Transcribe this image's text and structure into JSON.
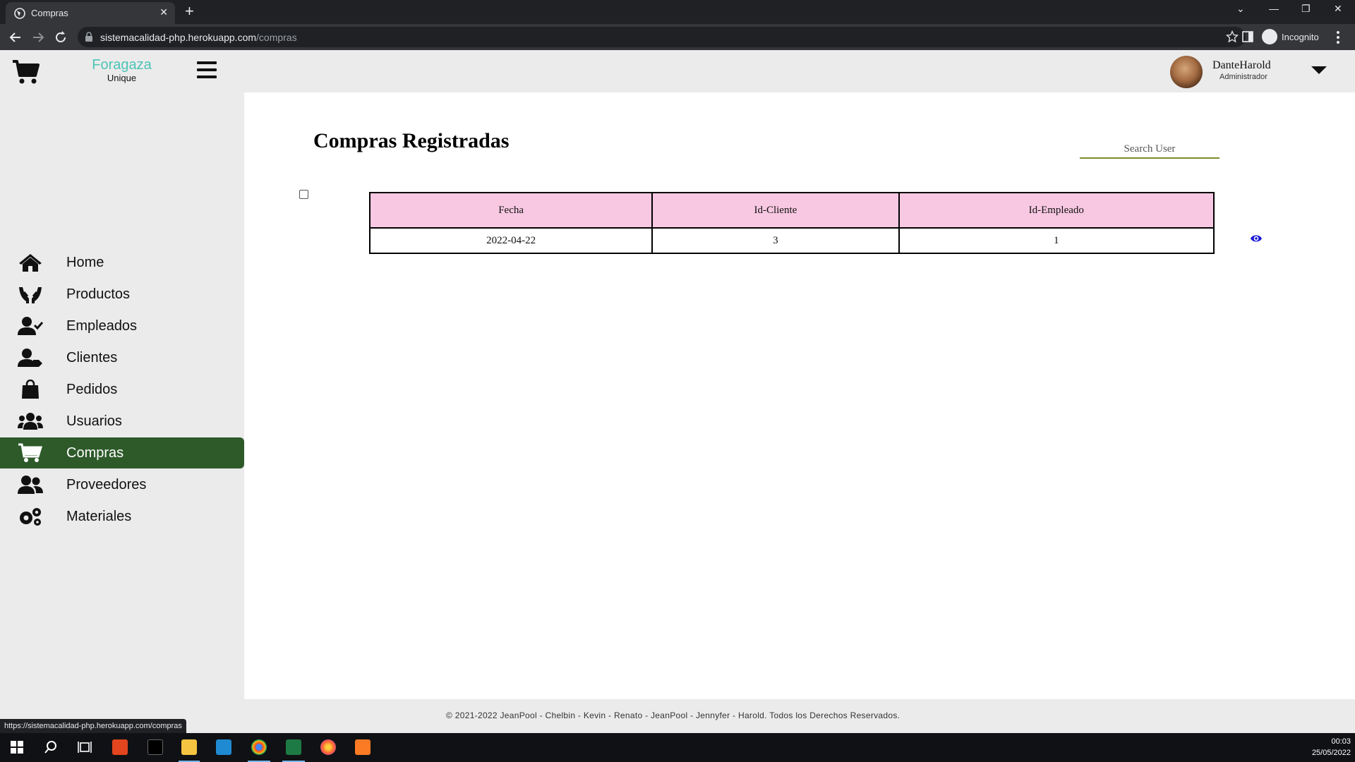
{
  "browser": {
    "tab_title": "Compras",
    "url_host": "sistemacalidad-php.herokuapp.com",
    "url_path": "/compras",
    "profile_label": "Incognito",
    "status_url": "https://sistemacalidad-php.herokuapp.com/compras"
  },
  "header": {
    "brand_name": "Foragaza",
    "brand_sub": "Unique",
    "user_name": "DanteHarold",
    "user_role": "Administrador"
  },
  "sidebar": {
    "items": [
      {
        "label": "Home",
        "icon": "home-icon"
      },
      {
        "label": "Productos",
        "icon": "hands-holding-icon"
      },
      {
        "label": "Empleados",
        "icon": "user-check-icon"
      },
      {
        "label": "Clientes",
        "icon": "user-tag-icon"
      },
      {
        "label": "Pedidos",
        "icon": "shopping-bag-icon"
      },
      {
        "label": "Usuarios",
        "icon": "users-icon"
      },
      {
        "label": "Compras",
        "icon": "shopping-cart-icon",
        "active": true
      },
      {
        "label": "Proveedores",
        "icon": "user-friends-icon"
      },
      {
        "label": "Materiales",
        "icon": "cogs-icon"
      }
    ]
  },
  "main": {
    "title": "Compras Registradas",
    "search_placeholder": "Search User",
    "table": {
      "columns": [
        "Fecha",
        "Id-Cliente",
        "Id-Empleado"
      ],
      "rows": [
        [
          "2022-04-22",
          "3",
          "1"
        ]
      ]
    }
  },
  "footer": {
    "text": "© 2021-2022 JeanPool - Chelbin - Kevin - Renato - JeanPool - Jennyfer - Harold. Todos los Derechos Reservados."
  },
  "taskbar": {
    "time": "00:03",
    "date": "25/05/2022"
  },
  "colors": {
    "active_nav": "#2e5a2a",
    "brand": "#4ec3b5",
    "table_header": "#f8c8e2",
    "search_underline": "#7a8c2e",
    "eye_icon": "#1a1ad6"
  }
}
